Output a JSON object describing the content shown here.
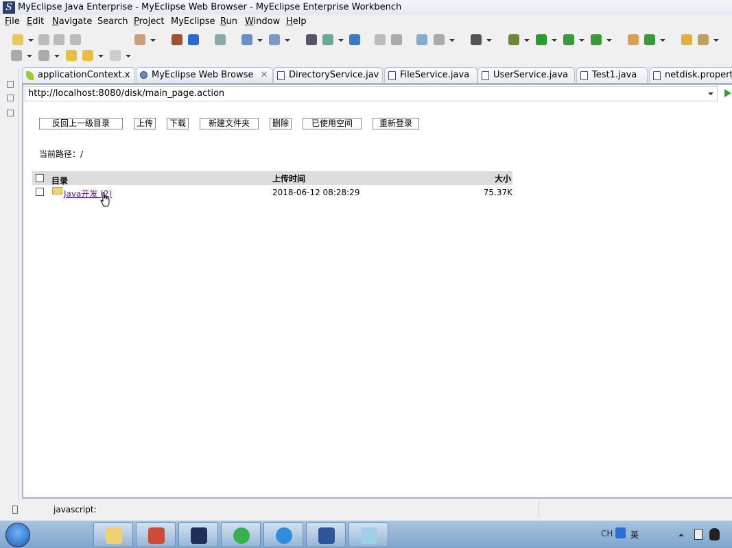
{
  "window": {
    "title": "MyEclipse Java Enterprise - MyEclipse Web Browser - MyEclipse Enterprise Workbench"
  },
  "menu": [
    {
      "label": "File",
      "u": "F",
      "rest": "ile"
    },
    {
      "label": "Edit",
      "u": "E",
      "rest": "dit"
    },
    {
      "label": "Navigate",
      "u": "N",
      "rest": "avigate"
    },
    {
      "label": "Search",
      "pre": "Se",
      "u": "a",
      "rest": "rch"
    },
    {
      "label": "Project",
      "u": "P",
      "rest": "roject"
    },
    {
      "label": "MyEclipse",
      "pre": "MyEclipse",
      "u": "",
      "rest": ""
    },
    {
      "label": "Run",
      "u": "R",
      "rest": "un"
    },
    {
      "label": "Window",
      "u": "W",
      "rest": "indow"
    },
    {
      "label": "Help",
      "u": "H",
      "rest": "elp"
    }
  ],
  "tabs": [
    {
      "label": "applicationContext.x",
      "icon": "spring-leaf-icon"
    },
    {
      "label": "MyEclipse Web Browse",
      "icon": "globe-icon",
      "active": true,
      "close": "✕"
    },
    {
      "label": "DirectoryService.jav",
      "icon": "java-file-icon"
    },
    {
      "label": "FileService.java",
      "icon": "java-file-icon"
    },
    {
      "label": "UserService.java",
      "icon": "java-file-icon"
    },
    {
      "label": "Test1.java",
      "icon": "java-file-icon"
    },
    {
      "label": "netdisk.propertie",
      "icon": "properties-file-icon"
    }
  ],
  "browser": {
    "url": "http://localhost:8080/disk/main_page.action"
  },
  "page": {
    "buttons": [
      "反回上一级目录",
      "上传",
      "下载",
      "新建文件夹",
      "删除",
      "已使用空间",
      "重新登录"
    ],
    "path_label": "当前路径：/",
    "columns": {
      "name": "目录",
      "time": "上传时间",
      "size": "大小"
    },
    "rows": [
      {
        "name": "Java开发 (2)",
        "time": "2018-06-12 08:28:29",
        "size": "75.37K"
      }
    ]
  },
  "status": {
    "text": "javascript:"
  },
  "tray": {
    "lang": "CH",
    "ime": "英"
  },
  "colors": {
    "link": "#551a8b",
    "taskbar": "#8fb3d8",
    "header_bg": "#dcdcdc"
  }
}
